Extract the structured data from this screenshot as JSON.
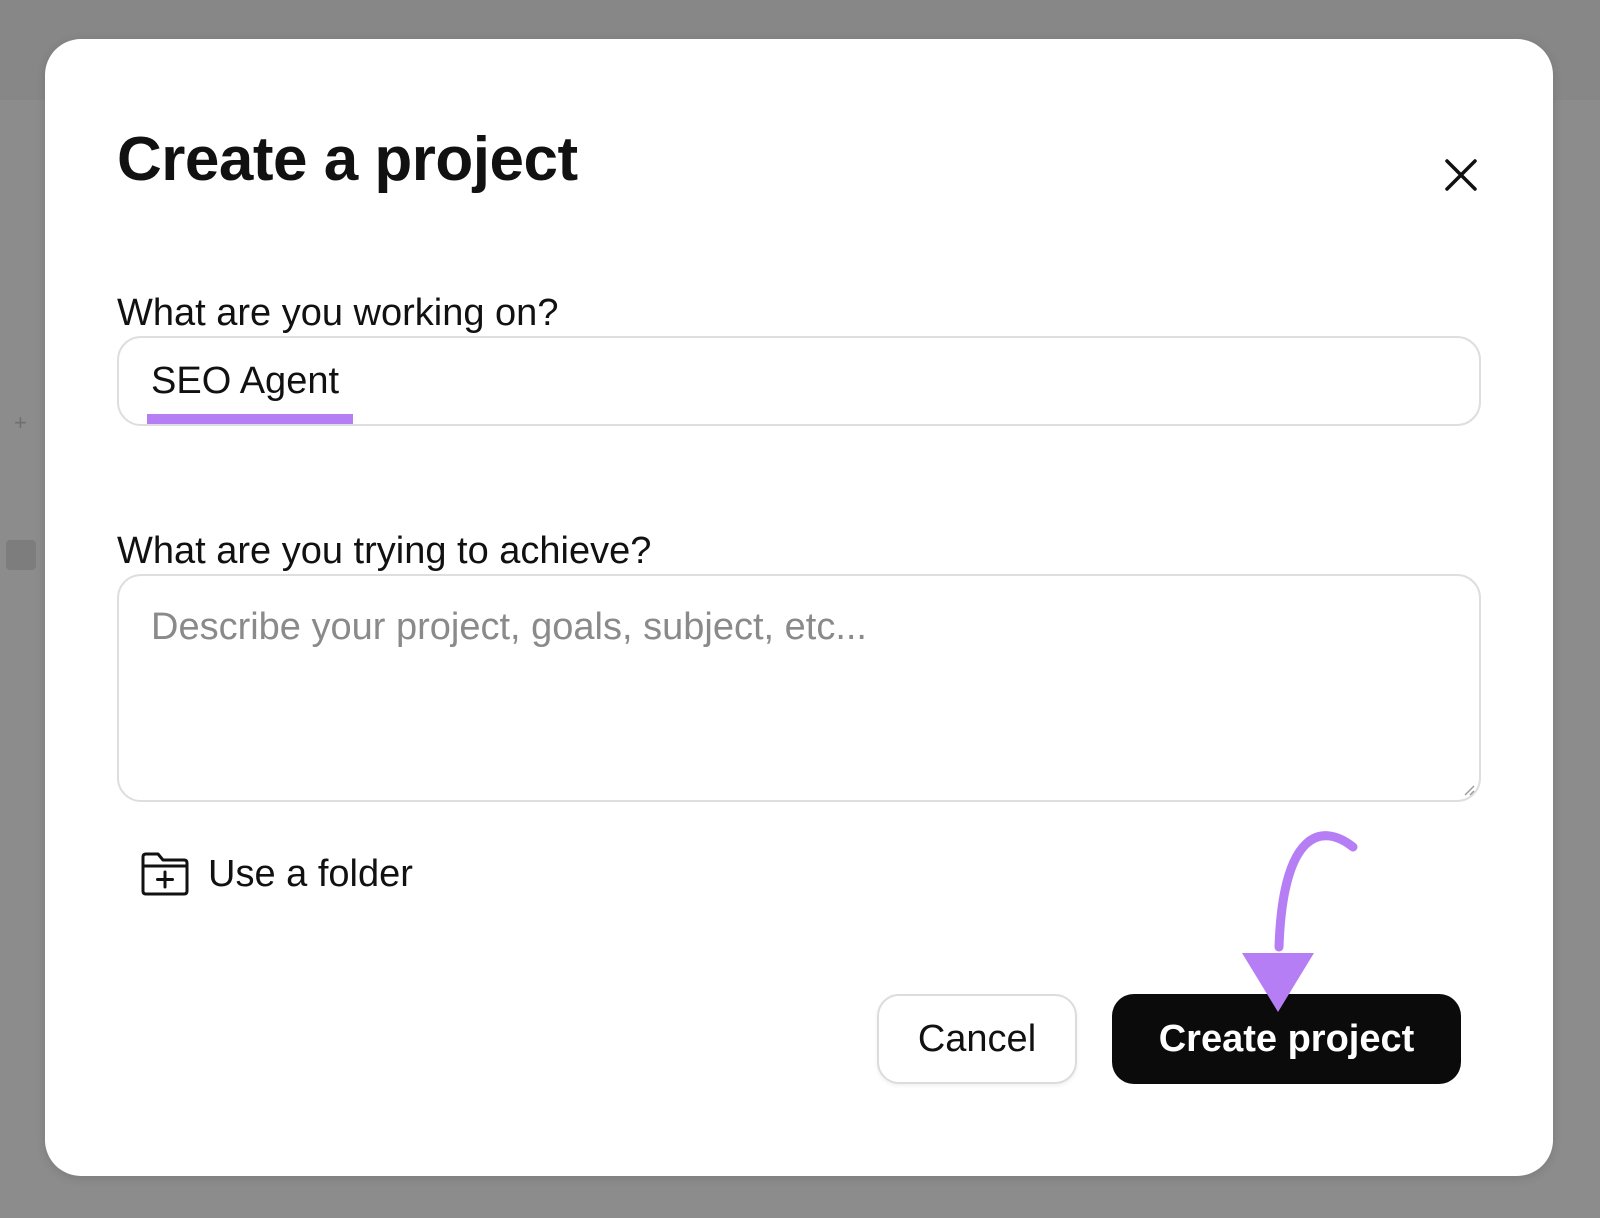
{
  "modal": {
    "title": "Create a project",
    "close_icon": "close-icon"
  },
  "form": {
    "name_label": "What are you working on?",
    "name_value": "SEO Agent",
    "goal_label": "What are you trying to achieve?",
    "goal_placeholder": "Describe your project, goals, subject, etc..."
  },
  "folder": {
    "icon": "folder-plus-icon",
    "label": "Use a folder"
  },
  "actions": {
    "cancel_label": "Cancel",
    "create_label": "Create project"
  },
  "colors": {
    "accent_purple": "#b57ef5",
    "primary_button": "#0b0b0b",
    "overlay": "#8c8c8c"
  }
}
